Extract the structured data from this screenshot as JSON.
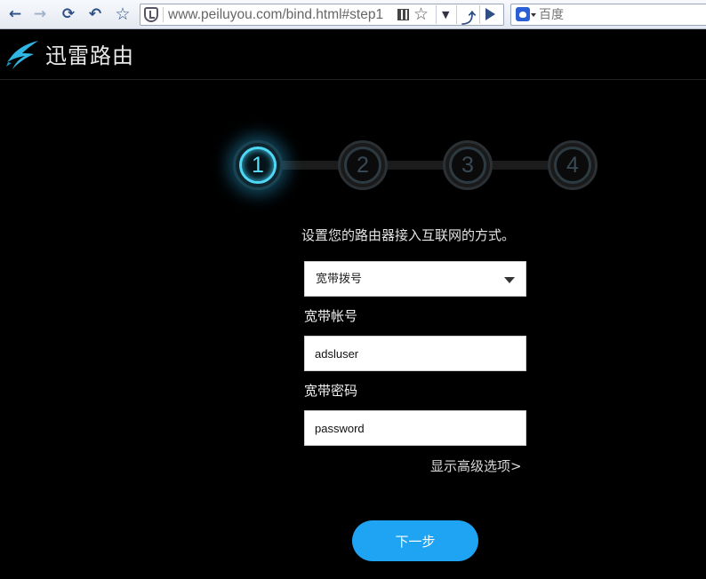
{
  "browser": {
    "url": "www.peiluyou.com/bind.html#step1",
    "search_placeholder": "百度"
  },
  "app": {
    "title": "迅雷路由"
  },
  "steps": [
    "1",
    "2",
    "3",
    "4"
  ],
  "active_step": 1,
  "form": {
    "intro": "设置您的路由器接入互联网的方式。",
    "connection_type": "宽带拨号",
    "account_label": "宽带帐号",
    "account_value": "adsluser",
    "password_label": "宽带密码",
    "password_value": "password",
    "advanced_link": "显示高级选项>",
    "next_label": "下一步"
  },
  "colors": {
    "accent": "#1ea4f2",
    "active_step": "#4fd8f6"
  }
}
